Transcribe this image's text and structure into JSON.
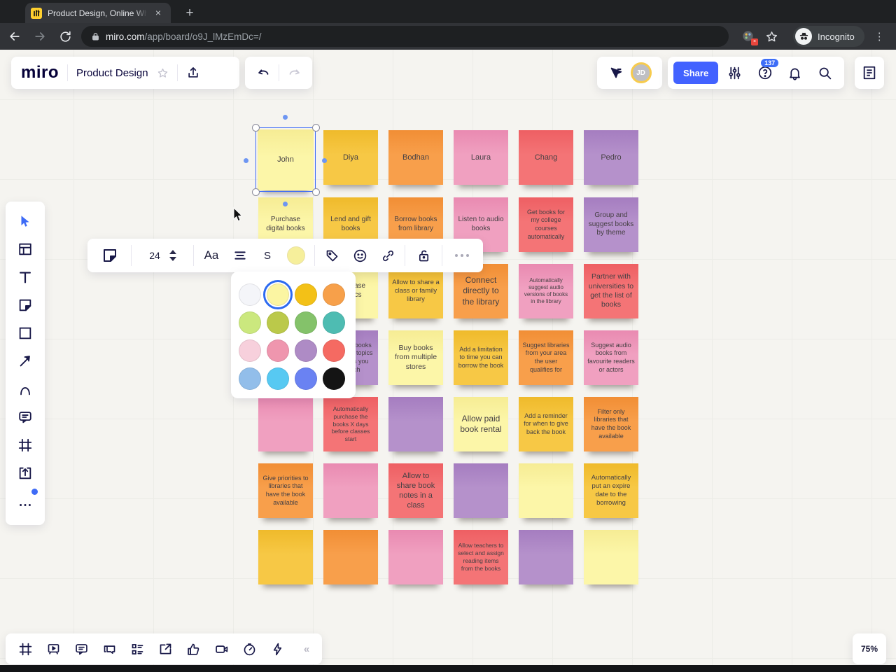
{
  "browser": {
    "tab_title": "Product Design, Online Whit",
    "url_domain": "miro.com",
    "url_path": "/app/board/o9J_lMzEmDc=/",
    "incognito_label": "Incognito"
  },
  "glyphs": {
    "tab_close": "×",
    "new_tab": "+",
    "help": "?",
    "menu_dots": "⋮",
    "collapse": "«"
  },
  "header": {
    "logo_text": "miro",
    "board_title": "Product Design",
    "share_label": "Share",
    "help_badge": "137",
    "avatar_initials": "JD"
  },
  "left_toolbar_icons": [
    "select",
    "templates",
    "text",
    "sticky-note",
    "shapes",
    "arrow",
    "pen",
    "comment",
    "frame",
    "upload",
    "more"
  ],
  "context_toolbar": {
    "icons": [
      "sticky-note",
      "font-size-stepper",
      "text-style",
      "align",
      "strikethrough",
      "fill-color",
      "tag",
      "emoji",
      "link",
      "lock",
      "more"
    ],
    "font_size_value": "24",
    "text_style_label": "Aa",
    "strike_label": "S"
  },
  "color_picker": {
    "selected_index": 1,
    "colors": [
      "#F4F5F9",
      "#FBF5A2",
      "#F3C117",
      "#F7A04A",
      "#CBE87E",
      "#BBC94A",
      "#84C26A",
      "#4EBCB2",
      "#F7D0DC",
      "#EF96AE",
      "#AE8BC5",
      "#F56A62",
      "#92BEEA",
      "#57C9F2",
      "#6A82F2",
      "#141414"
    ]
  },
  "board": {
    "note_colors": {
      "lightyellow": [
        "#F6EC94",
        "#FCF6A8"
      ],
      "gold": [
        "#EFBA2B",
        "#F7C845"
      ],
      "orange": [
        "#F18E35",
        "#F89F4B"
      ],
      "pink": [
        "#E98AB1",
        "#F0A0C0"
      ],
      "red": [
        "#EE5F63",
        "#F47476"
      ],
      "purple": [
        "#A57DC0",
        "#B591CB"
      ]
    },
    "notes": [
      {
        "row": 1,
        "col": 1,
        "color": "lightyellow",
        "text": "John",
        "fs": 11,
        "selected": true
      },
      {
        "row": 1,
        "col": 2,
        "color": "gold",
        "text": "Diya",
        "fs": 11
      },
      {
        "row": 1,
        "col": 3,
        "color": "orange",
        "text": "Bodhan",
        "fs": 11
      },
      {
        "row": 1,
        "col": 4,
        "color": "pink",
        "text": "Laura",
        "fs": 11
      },
      {
        "row": 1,
        "col": 5,
        "color": "red",
        "text": "Chang",
        "fs": 11
      },
      {
        "row": 1,
        "col": 6,
        "color": "purple",
        "text": "Pedro",
        "fs": 11
      },
      {
        "row": 2,
        "col": 1,
        "color": "lightyellow",
        "text": "Purchase digital books",
        "fs": 10
      },
      {
        "row": 2,
        "col": 2,
        "color": "gold",
        "text": "Lend and gift books",
        "fs": 10
      },
      {
        "row": 2,
        "col": 3,
        "color": "orange",
        "text": "Borrow books from library",
        "fs": 10
      },
      {
        "row": 2,
        "col": 4,
        "color": "pink",
        "text": "Listen to audio books",
        "fs": 10
      },
      {
        "row": 2,
        "col": 5,
        "color": "red",
        "text": "Get books for my college courses automatically",
        "fs": 9
      },
      {
        "row": 2,
        "col": 6,
        "color": "purple",
        "text": "Group and suggest books by theme",
        "fs": 10
      },
      {
        "row": 3,
        "col": 1,
        "color": "lightyellow",
        "text": "",
        "fs": 9
      },
      {
        "row": 3,
        "col": 2,
        "color": "lightyellow",
        "text": "Purchase comics",
        "fs": 10
      },
      {
        "row": 3,
        "col": 3,
        "color": "gold",
        "text": "Allow to share a class or family library",
        "fs": 9.5
      },
      {
        "row": 3,
        "col": 4,
        "color": "orange",
        "text": "Connect directly to the library",
        "fs": 12
      },
      {
        "row": 3,
        "col": 5,
        "color": "pink",
        "text": "Automatically suggest audio versions of books in the library",
        "fs": 8
      },
      {
        "row": 3,
        "col": 6,
        "color": "red",
        "text": "Partner with universities to get the list of books",
        "fs": 10.5
      },
      {
        "row": 4,
        "col": 1,
        "color": "gold",
        "text": "",
        "fs": 9
      },
      {
        "row": 4,
        "col": 2,
        "color": "purple",
        "text": "Suggest books based on topics of books you search",
        "fs": 9
      },
      {
        "row": 4,
        "col": 3,
        "color": "lightyellow",
        "text": "Buy books from multiple stores",
        "fs": 10.5
      },
      {
        "row": 4,
        "col": 4,
        "color": "gold",
        "text": "Add a limitation to time you can borrow the book",
        "fs": 9
      },
      {
        "row": 4,
        "col": 5,
        "color": "orange",
        "text": "Suggest libraries from your area the user qualifies for",
        "fs": 9
      },
      {
        "row": 4,
        "col": 6,
        "color": "pink",
        "text": "Suggest audio books from favourite readers or actors",
        "fs": 9
      },
      {
        "row": 5,
        "col": 1,
        "color": "pink",
        "text": "",
        "fs": 9
      },
      {
        "row": 5,
        "col": 2,
        "color": "red",
        "text": "Automatically purchase the books X days before classes start",
        "fs": 8.5
      },
      {
        "row": 5,
        "col": 3,
        "color": "purple",
        "text": "",
        "fs": 9
      },
      {
        "row": 5,
        "col": 4,
        "color": "lightyellow",
        "text": "Allow paid book rental",
        "fs": 12
      },
      {
        "row": 5,
        "col": 5,
        "color": "gold",
        "text": "Add a reminder for when to give back the book",
        "fs": 9
      },
      {
        "row": 5,
        "col": 6,
        "color": "orange",
        "text": "Filter only libraries that have the book available",
        "fs": 9
      },
      {
        "row": 6,
        "col": 1,
        "color": "orange",
        "text": "Give priorities to libraries that have the book available",
        "fs": 9
      },
      {
        "row": 6,
        "col": 2,
        "color": "pink",
        "text": "",
        "fs": 9
      },
      {
        "row": 6,
        "col": 3,
        "color": "red",
        "text": "Allow to share book notes in a class",
        "fs": 11
      },
      {
        "row": 6,
        "col": 4,
        "color": "purple",
        "text": "",
        "fs": 9
      },
      {
        "row": 6,
        "col": 5,
        "color": "lightyellow",
        "text": "",
        "fs": 9
      },
      {
        "row": 6,
        "col": 6,
        "color": "gold",
        "text": "Automatically put an expire date to the borrowing",
        "fs": 9.5
      },
      {
        "row": 7,
        "col": 1,
        "color": "gold",
        "text": "",
        "fs": 9
      },
      {
        "row": 7,
        "col": 2,
        "color": "orange",
        "text": "",
        "fs": 9
      },
      {
        "row": 7,
        "col": 3,
        "color": "pink",
        "text": "",
        "fs": 9
      },
      {
        "row": 7,
        "col": 4,
        "color": "red",
        "text": "Allow teachers to select and assign reading items from the books",
        "fs": 8.5
      },
      {
        "row": 7,
        "col": 5,
        "color": "purple",
        "text": "",
        "fs": 9
      },
      {
        "row": 7,
        "col": 6,
        "color": "lightyellow",
        "text": "",
        "fs": 9
      }
    ]
  },
  "bottom_toolbar_icons": [
    "frame",
    "presentation",
    "comments",
    "chat",
    "cards",
    "share-screen",
    "reactions",
    "video-chat",
    "timer",
    "quick-actions",
    "collapse"
  ],
  "zoom_indicator": "75%"
}
